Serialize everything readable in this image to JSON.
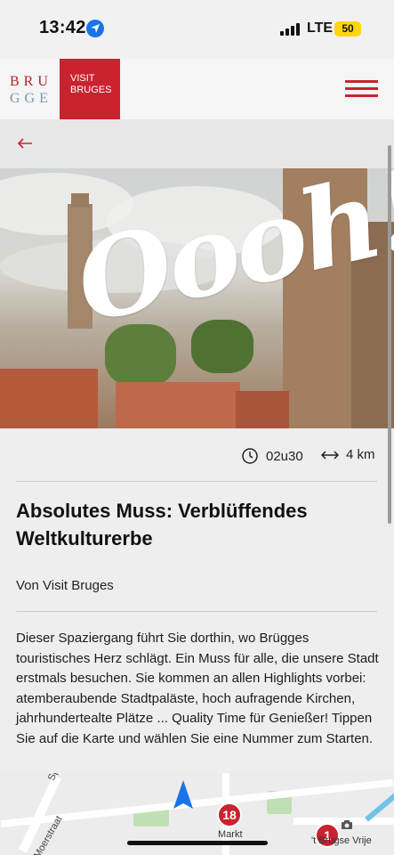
{
  "status_bar": {
    "time": "13:42",
    "network": "LTE",
    "battery": "50"
  },
  "header": {
    "logo_line1": "BRU",
    "logo_line2": "GGE",
    "logo_box": "VISIT\nBRUGES"
  },
  "hero": {
    "overlay_text": "Oooh!"
  },
  "meta": {
    "duration": "02u30",
    "distance": "4 km"
  },
  "article": {
    "title": "Absolutes Muss: Verblüffendes Weltkulturerbe",
    "author": "Von Visit Bruges",
    "description": "Dieser Spaziergang führt Sie dorthin, wo Brügges touristisches Herz schlägt. Ein Muss für alle, die unsere Stadt erstmals besuchen. Sie kommen an allen Highlights vorbei: atemberaubende Stadtpaläste, hoch aufragende Kirchen, jahrhundertealte Plätze ... Quality Time für Genießer! Tippen Sie auf die Karte und wählen Sie eine Nummer zum Starten."
  },
  "map": {
    "street_1": "Moerstraat",
    "street_2": "Sp",
    "marker_18": "18",
    "marker_18_label": "Markt",
    "marker_1": "1",
    "marker_1_label": "'t Brugse Vrije"
  },
  "colors": {
    "brand_red": "#c8232f",
    "logo_blue": "#7f95b2",
    "nav_blue": "#1a73e8"
  }
}
